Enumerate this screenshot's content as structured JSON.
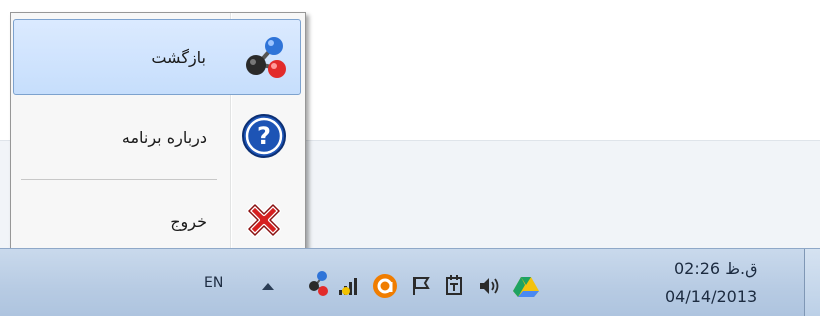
{
  "menu": {
    "items": [
      {
        "label": "بازگشت",
        "icon": "molecule-icon",
        "highlighted": true
      },
      {
        "label": "درباره برنامه",
        "icon": "help-icon",
        "highlighted": false
      },
      {
        "label": "خروج",
        "icon": "exit-icon",
        "highlighted": false
      }
    ]
  },
  "taskbar": {
    "language": "EN",
    "tray_icons": [
      "molecule-icon",
      "signal-icon",
      "orange-app-icon",
      "flag-icon",
      "power-icon",
      "volume-icon",
      "drive-icon"
    ],
    "clock_time": "ق.ظ 02:26",
    "clock_date": "04/14/2013"
  },
  "colors": {
    "highlight": "#c6defc",
    "taskbar": "#b7cbe3"
  }
}
